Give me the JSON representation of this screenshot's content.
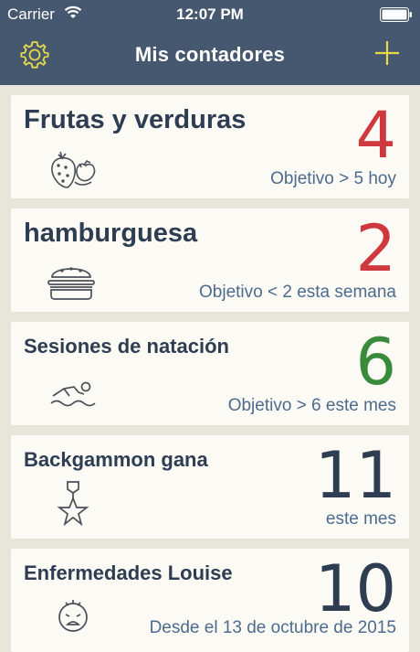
{
  "status": {
    "carrier": "Carrier",
    "time": "12:07 PM"
  },
  "nav": {
    "title": "Mis contadores",
    "settings_icon": "gear-icon",
    "add_icon": "plus-icon"
  },
  "colors": {
    "nav_bg": "#46586f",
    "accent_yellow": "#e8d84a",
    "red": "#d0383f",
    "green": "#3a8a3b",
    "navy": "#2f3d52",
    "goal_text": "#4d6b8e",
    "background": "#e8e6da",
    "card": "#fbfaf4"
  },
  "counters": [
    {
      "title": "Frutas y verduras",
      "count": "4",
      "goal": "Objetivo > 5 hoy",
      "icon": "strawberry-icon",
      "status": "red"
    },
    {
      "title": "hamburguesa",
      "count": "2",
      "goal": "Objetivo < 2 esta semana",
      "icon": "hamburger-icon",
      "status": "red"
    },
    {
      "title": "Sesiones de natación",
      "count": "6",
      "goal": "Objetivo > 6 este mes",
      "icon": "swimmer-icon",
      "status": "green"
    },
    {
      "title": "Backgammon gana",
      "count": "11",
      "goal": "este mes",
      "icon": "medal-icon",
      "status": "navy"
    },
    {
      "title": "Enfermedades Louise",
      "count": "10",
      "goal": "Desde el 13 de octubre de 2015",
      "icon": "sick-face-icon",
      "status": "navy"
    }
  ]
}
